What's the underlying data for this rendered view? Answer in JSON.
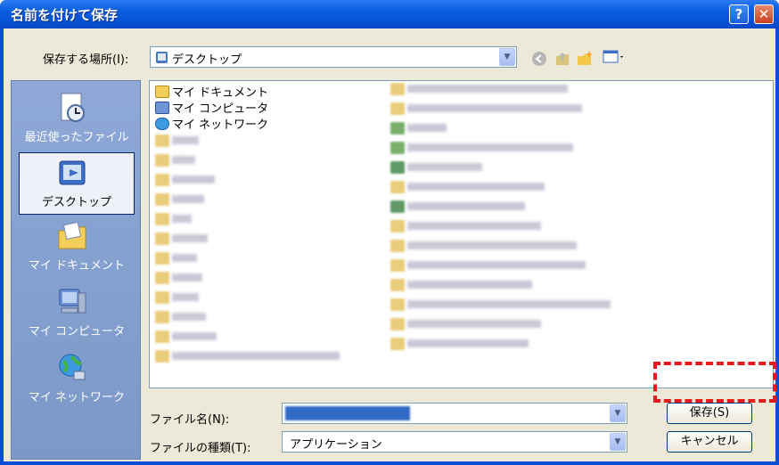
{
  "window": {
    "title": "名前を付けて保存",
    "help_label": "?",
    "close_label": "✕"
  },
  "save_in": {
    "label": "保存する場所(I):",
    "value": "デスクトップ"
  },
  "places": [
    {
      "label": "最近使ったファイル",
      "icon": "recent-icon"
    },
    {
      "label": "デスクトップ",
      "icon": "desktop-icon",
      "selected": true
    },
    {
      "label": "マイ ドキュメント",
      "icon": "my-documents-icon"
    },
    {
      "label": "マイ コンピュータ",
      "icon": "my-computer-icon"
    },
    {
      "label": "マイ ネットワーク",
      "icon": "my-network-icon"
    }
  ],
  "file_list": {
    "items": [
      {
        "label": "マイ ドキュメント",
        "icon": "my-documents-icon"
      },
      {
        "label": "マイ コンピュータ",
        "icon": "my-computer-icon"
      },
      {
        "label": "マイ ネットワーク",
        "icon": "my-network-icon"
      }
    ]
  },
  "file_name": {
    "label": "ファイル名(N):",
    "value": ""
  },
  "file_type": {
    "label": "ファイルの種類(T):",
    "value": "アプリケーション"
  },
  "buttons": {
    "save": "保存(S)",
    "cancel": "キャンセル"
  },
  "colors": {
    "title_bar": "#0a5fe0",
    "highlight": "#e61a1a",
    "places_bg": "#7b98c7"
  }
}
